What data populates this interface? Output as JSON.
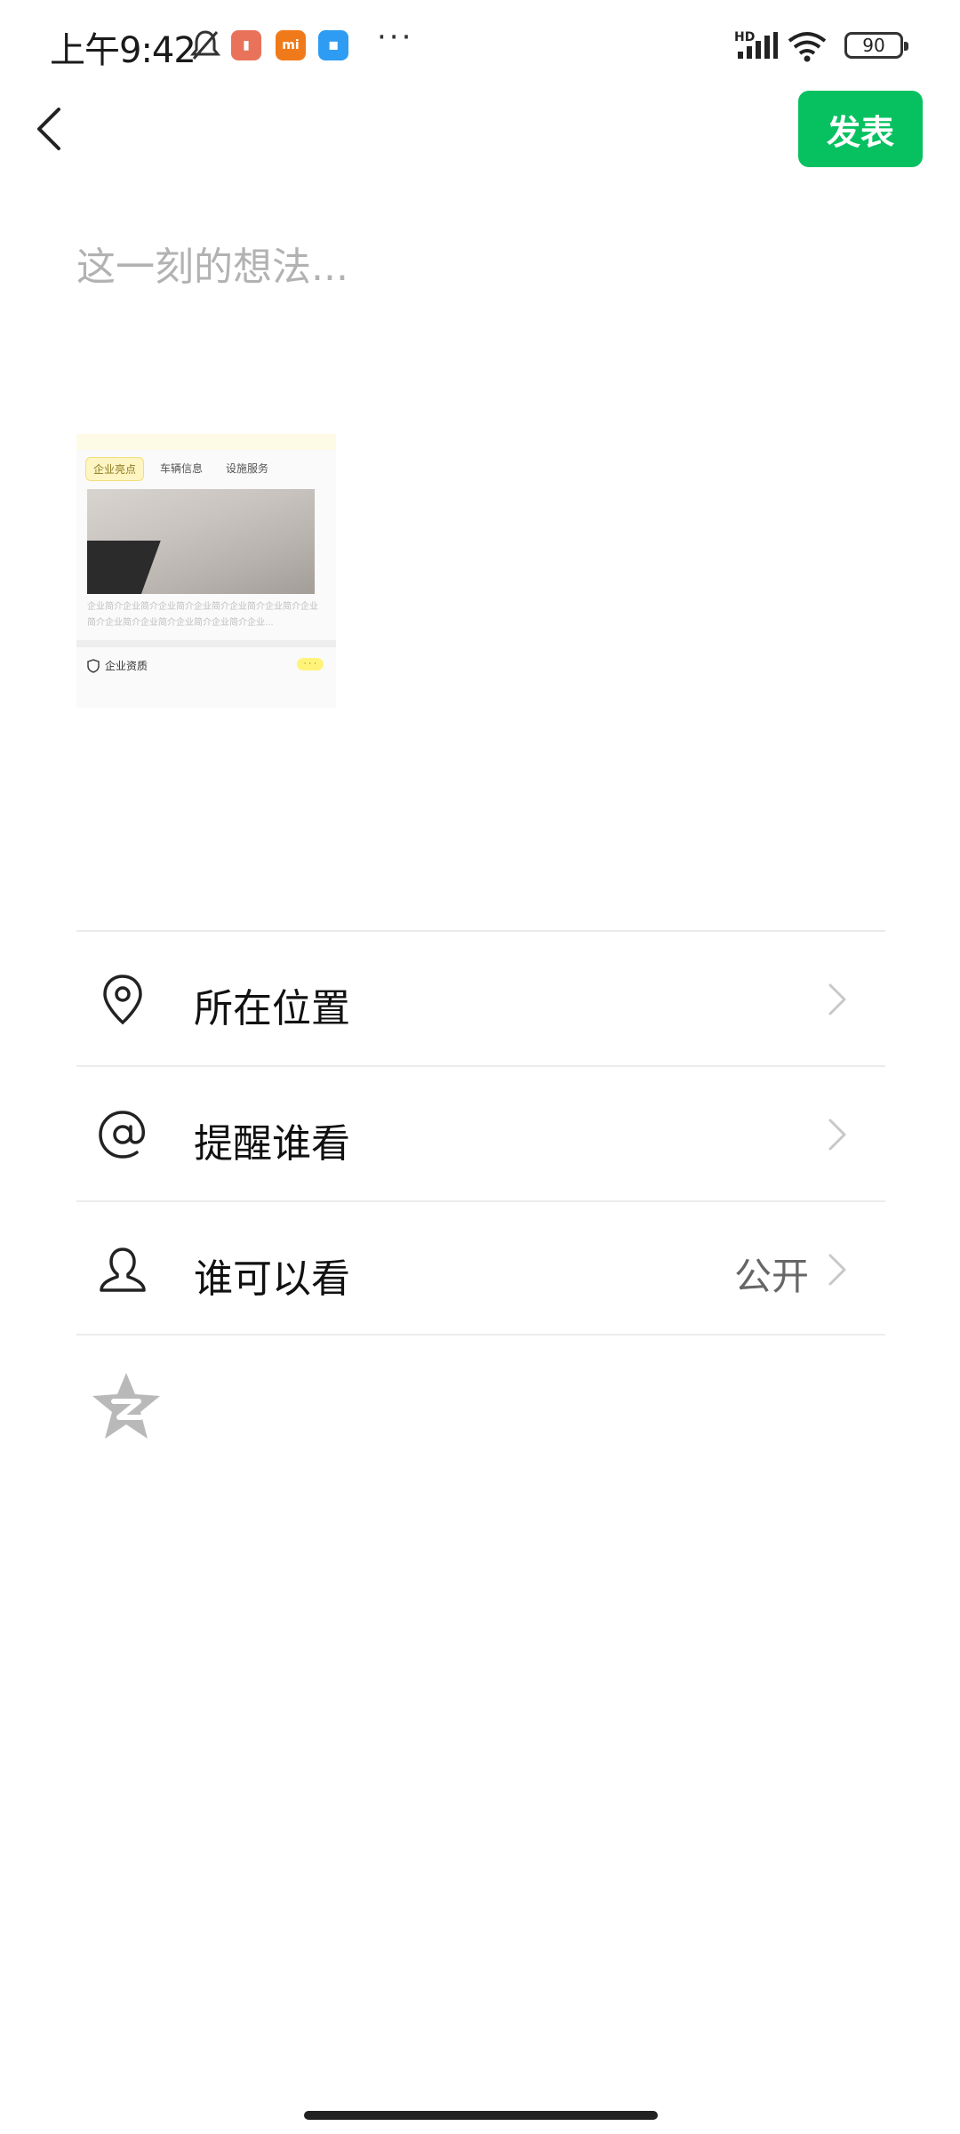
{
  "status_bar": {
    "time": "上午9:42",
    "battery": "90",
    "network": "HD"
  },
  "header": {
    "publish_label": "发表"
  },
  "composer": {
    "placeholder": "这一刻的想法..."
  },
  "attachment": {
    "tags": [
      "企业亮点",
      "车辆信息",
      "设施服务"
    ],
    "description": "企业简介企业简介企业简介企业简介企业简介企业简介企业简介企业简介企业简介企业简介企业简介企业...",
    "footer_label": "企业资质"
  },
  "options": [
    {
      "label": "所在位置",
      "value": "",
      "icon": "location-icon"
    },
    {
      "label": "提醒谁看",
      "value": "",
      "icon": "at-icon"
    },
    {
      "label": "谁可以看",
      "value": "公开",
      "icon": "person-icon"
    }
  ],
  "colors": {
    "accent": "#07c160",
    "placeholder": "#b2b2b2",
    "divider": "#ececec"
  }
}
